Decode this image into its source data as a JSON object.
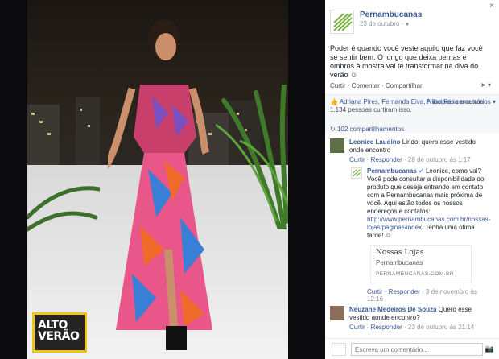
{
  "photo": {
    "badge_line1": "ALTO",
    "badge_line2": "VERÃO",
    "badge_color": "#f3c316"
  },
  "post": {
    "page_name": "Pernambucanas",
    "date": "23 de outubro · ",
    "privacy_icon": "globe-icon",
    "text": "Poder é quando você veste aquilo que faz você se sentir bem. O longo que deixa pernas e ombros à mostra vai te transformar na diva do verão ",
    "close_label": "×"
  },
  "actions": {
    "like": "Curtir",
    "sep1": " · ",
    "comment": "Comentar",
    "sep2": " · ",
    "share": "Compartilhar",
    "share_icon": "share-icon"
  },
  "likes": {
    "names_prefix": "Adriana Pires, Fernanda Eiva, Nilba Faria",
    "count_text": " e outras 1.134 pessoas curtiram isso.",
    "top_comments": "Principais comentários ▾",
    "shares": "102 compartilhamentos"
  },
  "comments": [
    {
      "author": "Leonice Laudino",
      "text": " Lindo, quero esse vestido onde encontro",
      "like": "Curtir",
      "reply": "Responder",
      "date": " · 28 de outubro às 1:17"
    },
    {
      "author": "Pernambucanas",
      "text": " Leonice, como vai? Você pode consultar a disponibilidade do produto que deseja entrando em contato com a Pernambucanas mais próxima de você. Aqui estão todos os nossos endereços e contatos:",
      "link": "http://www.pernambucanas.com.br/nossas-lojas/paginas/index",
      "closing": ". Tenha uma ótima tarde! ",
      "card_title": "Nossas Lojas",
      "card_sub": "Pernambucanas",
      "card_url": "PERNAMBUCANAS.COM.BR",
      "like": "Curtir",
      "reply": "Responder",
      "date": " · 3 de novembro às 12:16"
    },
    {
      "author": "Neuzane Medeiros De Souza",
      "text": " Quero esse vestido aonde encontro?",
      "like": "Curtir",
      "reply": "Responder",
      "date": " · 23 de outubro às 21:14"
    }
  ],
  "reply_box": {
    "placeholder": "Escreva um comentário...",
    "camera_icon": "camera-icon"
  }
}
